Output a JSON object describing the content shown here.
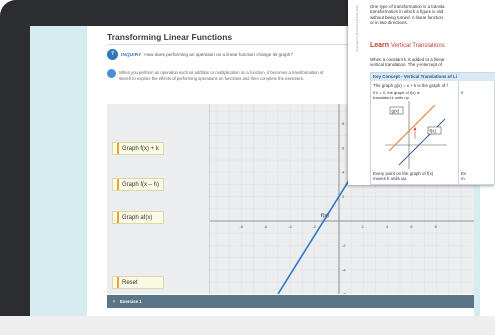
{
  "app": {
    "title": "Transforming Linear Functions",
    "inquiry_label": "INQUIRY",
    "inquiry_question": "How does performing an operation on a linear function change its graph?",
    "instruction_line1": "When you perform an operation such as addition or multiplication on a function, it becomes a transformation of",
    "instruction_line2": "sketch to explore the effects of performing operations on functions and then complete the exercises."
  },
  "buttons": {
    "graph_k": "Graph f(x) + k",
    "graph_h": "Graph f(x – h)",
    "graph_a": "Graph af(x)",
    "reset": "Reset"
  },
  "graph": {
    "fx_label": "f(x)",
    "x_ticks": [
      "-8",
      "-6",
      "-4",
      "-2",
      "2",
      "4",
      "6",
      "8"
    ],
    "y_ticks": [
      "8",
      "6",
      "4",
      "2",
      "-2",
      "-4",
      "-6",
      "-8"
    ],
    "line_color": "#2f78c8"
  },
  "exercise": {
    "label": "Exercise 1"
  },
  "textbook": {
    "intro_lines": [
      "One type of transformation is a transla",
      "transformation in which a figure is slid",
      "without being turned. A linear function",
      "or in two directions."
    ],
    "learn_word": "Learn",
    "learn_topic": "Vertical Translations",
    "para_lines": [
      "When a constant k is added to a linear",
      "vertical translation. The y-intercept of"
    ],
    "copyright": "Copyright © McGraw-Hill Education",
    "key_concept": "Key Concept - Vertical Translations of Li",
    "kc_line1": "The graph g(x) = x + k is the graph of f",
    "kc_if": "If k > 0, the graph of f(x) is",
    "kc_translated": "translated k units up.",
    "kc_right_if": "If",
    "kc_label_top": "g(x)",
    "kc_label_bottom": "f(x)",
    "kc_footer_line1": "Every point on the graph of f(x)",
    "kc_footer_line2": "moves k units up.",
    "kc_footer_right1": "Ev",
    "kc_footer_right2": "m",
    "accent_color": "#c8402e"
  }
}
